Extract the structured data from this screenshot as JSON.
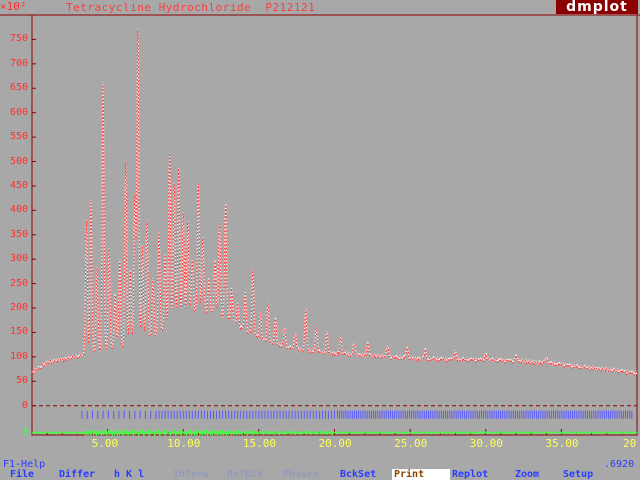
{
  "window": {
    "title": "Tetracycline Hydrochloride  P212121",
    "app_logo": "dmplot",
    "y_scale": "×10²"
  },
  "chart_data": {
    "type": "line",
    "xlim": [
      2.0,
      20.0
    ],
    "ylim": [
      -60,
      800
    ],
    "xticks": [
      5,
      10,
      15,
      20,
      25,
      30,
      35,
      20
    ],
    "x_tick_labels": [
      "5.00",
      "10.00",
      "15.00",
      "20.00",
      "25.00",
      "30.00",
      "35.00",
      "20"
    ],
    "yticks": [
      0,
      50,
      100,
      150,
      200,
      250,
      300,
      350,
      400,
      450,
      500,
      550,
      600,
      650,
      700,
      750
    ],
    "y_tick_labels": [
      "0",
      "50",
      "100",
      "150",
      "200",
      "250",
      "300",
      "350",
      "400",
      "450",
      "500",
      "550",
      "600",
      "650",
      "700",
      "750"
    ],
    "background_curve": {
      "x": [
        0.0,
        1.0,
        2.0,
        3.0,
        4.0,
        5.0,
        6.0,
        7.0,
        8.0,
        9.0,
        10.0,
        11.0,
        12.0,
        13.0,
        14.0,
        15.0,
        16.0,
        17.0,
        18.0,
        19.0,
        20.0,
        21.0,
        22.0,
        23.0,
        24.0,
        25.0,
        26.0,
        28.0,
        30.0,
        32.0,
        34.0,
        35.0,
        36.0,
        37.0,
        38.0,
        39.0,
        40.0
      ],
      "y": [
        68,
        88,
        95,
        101,
        108,
        116,
        123,
        131,
        143,
        160,
        182,
        196,
        191,
        178,
        157,
        139,
        127,
        119,
        114,
        110,
        107,
        105,
        103,
        101,
        99,
        97,
        96,
        95,
        94,
        92,
        88,
        85,
        80,
        77,
        74,
        71,
        66
      ]
    },
    "peaks": [
      {
        "x": 3.6,
        "y": 380
      },
      {
        "x": 3.9,
        "y": 420
      },
      {
        "x": 4.3,
        "y": 290
      },
      {
        "x": 4.7,
        "y": 670
      },
      {
        "x": 5.1,
        "y": 320
      },
      {
        "x": 5.5,
        "y": 230
      },
      {
        "x": 5.8,
        "y": 300
      },
      {
        "x": 6.2,
        "y": 510
      },
      {
        "x": 6.5,
        "y": 280
      },
      {
        "x": 6.8,
        "y": 430
      },
      {
        "x": 7.0,
        "y": 780
      },
      {
        "x": 7.3,
        "y": 330
      },
      {
        "x": 7.6,
        "y": 380
      },
      {
        "x": 8.0,
        "y": 260
      },
      {
        "x": 8.4,
        "y": 360
      },
      {
        "x": 8.8,
        "y": 310
      },
      {
        "x": 9.1,
        "y": 530
      },
      {
        "x": 9.4,
        "y": 460
      },
      {
        "x": 9.7,
        "y": 490
      },
      {
        "x": 10.0,
        "y": 400
      },
      {
        "x": 10.3,
        "y": 380
      },
      {
        "x": 10.6,
        "y": 300
      },
      {
        "x": 11.0,
        "y": 460
      },
      {
        "x": 11.3,
        "y": 350
      },
      {
        "x": 11.7,
        "y": 260
      },
      {
        "x": 12.1,
        "y": 300
      },
      {
        "x": 12.4,
        "y": 380
      },
      {
        "x": 12.8,
        "y": 420
      },
      {
        "x": 13.2,
        "y": 240
      },
      {
        "x": 13.6,
        "y": 210
      },
      {
        "x": 14.1,
        "y": 230
      },
      {
        "x": 14.6,
        "y": 280
      },
      {
        "x": 15.1,
        "y": 190
      },
      {
        "x": 15.6,
        "y": 210
      },
      {
        "x": 16.1,
        "y": 180
      },
      {
        "x": 16.7,
        "y": 160
      },
      {
        "x": 17.4,
        "y": 150
      },
      {
        "x": 18.1,
        "y": 200
      },
      {
        "x": 18.8,
        "y": 160
      },
      {
        "x": 19.5,
        "y": 150
      },
      {
        "x": 20.4,
        "y": 140
      },
      {
        "x": 21.3,
        "y": 130
      },
      {
        "x": 22.2,
        "y": 130
      },
      {
        "x": 23.5,
        "y": 125
      },
      {
        "x": 24.8,
        "y": 120
      },
      {
        "x": 26.0,
        "y": 115
      },
      {
        "x": 28.0,
        "y": 110
      },
      {
        "x": 30.0,
        "y": 108
      },
      {
        "x": 32.0,
        "y": 104
      },
      {
        "x": 34.0,
        "y": 100
      }
    ]
  },
  "status": {
    "help": "F1-Help",
    "readout": ".6920"
  },
  "menu": [
    {
      "label": "File",
      "state": "normal"
    },
    {
      "label": "Differ",
      "state": "normal"
    },
    {
      "label": "h K l",
      "state": "normal"
    },
    {
      "label": "Intens",
      "state": "disabled"
    },
    {
      "label": "RefBck",
      "state": "disabled"
    },
    {
      "label": "Phases",
      "state": "disabled"
    },
    {
      "label": "BckSet",
      "state": "normal"
    },
    {
      "label": "Print",
      "state": "active"
    },
    {
      "label": "Replot",
      "state": "normal"
    },
    {
      "label": "Zoom",
      "state": "normal"
    },
    {
      "label": "Setup",
      "state": "normal"
    }
  ],
  "colors": {
    "background": "#a8a8a8",
    "frame": "#8b0000",
    "calc_curve": "#ff2a2a",
    "obs_curve": "#ffffff",
    "reflection_ticks": "#5a5aff",
    "difference_curve": "#44ff44",
    "zero_line": "#8b0000"
  }
}
